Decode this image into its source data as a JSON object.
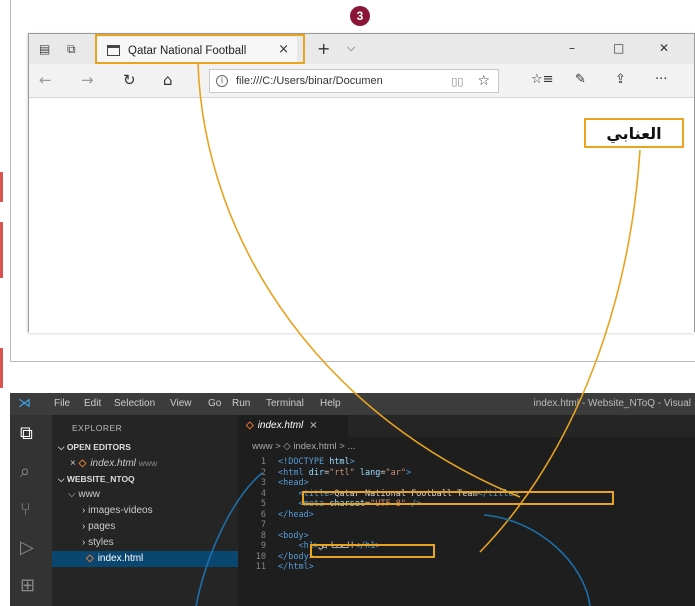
{
  "step_badge": "3",
  "colors": {
    "highlight": "#e8a320",
    "connector_blue": "#1c6fa8",
    "badge": "#8b1538",
    "vscode_bg": "#1e1e1e"
  },
  "browser": {
    "icons": {
      "tab_actions": "tab-actions-icon",
      "tab_preview": "tab-preview-icon",
      "page": "page-icon"
    },
    "tab_title": "Qatar National Football",
    "tab_close": "×",
    "new_tab": "+",
    "tab_list": "⌵",
    "window_buttons": {
      "minimize": "–",
      "maximize": "□",
      "close": "✕"
    },
    "nav": {
      "back": "←",
      "forward": "→",
      "refresh": "↻",
      "home": "⌂"
    },
    "address_url": "file:///C:/Users/binar/Documen",
    "toolbar_icons": [
      "favorites-icon",
      "pen-icon",
      "share-icon",
      "more-icon"
    ],
    "page_heading": "العنابي"
  },
  "vscode": {
    "menu": [
      "File",
      "Edit",
      "Selection",
      "View",
      "Go",
      "Run",
      "Terminal",
      "Help"
    ],
    "window_title": "index.html - Website_NToQ - Visual",
    "explorer": {
      "title": "EXPLORER",
      "open_editors_label": "OPEN EDITORS",
      "open_file": "index.html",
      "open_file_folder": "www",
      "workspace_label": "WEBSITE_NTOQ",
      "folder": "www",
      "subfolders": [
        "images-videos",
        "pages",
        "styles"
      ],
      "file": "index.html"
    },
    "editor_tab": "index.html",
    "breadcrumb": "www > ◇ index.html > ...",
    "code_lines": [
      {
        "n": "1",
        "parts": [
          [
            "tg",
            "<!DOCTYPE "
          ],
          [
            "at",
            "html"
          ],
          [
            "tg",
            ">"
          ]
        ]
      },
      {
        "n": "2",
        "parts": [
          [
            "tg",
            "<html "
          ],
          [
            "at",
            "dir"
          ],
          [
            "tx",
            "="
          ],
          [
            "st",
            "\"rtl\""
          ],
          [
            "tx",
            " "
          ],
          [
            "at",
            "lang"
          ],
          [
            "tx",
            "="
          ],
          [
            "st",
            "\"ar\""
          ],
          [
            "tg",
            ">"
          ]
        ]
      },
      {
        "n": "3",
        "parts": [
          [
            "tg",
            "<head>"
          ]
        ]
      },
      {
        "n": "4",
        "parts": [
          [
            "tx",
            "    "
          ],
          [
            "tg",
            "<title>"
          ],
          [
            "tx",
            "Qatar National Football Team"
          ],
          [
            "tg",
            "</title>"
          ]
        ]
      },
      {
        "n": "5",
        "parts": [
          [
            "tx",
            "    "
          ],
          [
            "tg",
            "<meta "
          ],
          [
            "at",
            "charset"
          ],
          [
            "tx",
            "="
          ],
          [
            "st",
            "\"UTF-8\""
          ],
          [
            "tx",
            " "
          ],
          [
            "tg",
            "/>"
          ]
        ]
      },
      {
        "n": "6",
        "parts": [
          [
            "tg",
            "</head>"
          ]
        ]
      },
      {
        "n": "7",
        "parts": []
      },
      {
        "n": "8",
        "parts": [
          [
            "tg",
            "<body>"
          ]
        ]
      },
      {
        "n": "9",
        "parts": [
          [
            "tx",
            "    "
          ],
          [
            "tg",
            "<h1>"
          ],
          [
            "tx",
            "العنابي"
          ],
          [
            "tg",
            "</h1>"
          ]
        ]
      },
      {
        "n": "10",
        "parts": [
          [
            "tg",
            "</body>"
          ]
        ]
      },
      {
        "n": "11",
        "parts": [
          [
            "tg",
            "</html>"
          ]
        ]
      }
    ]
  }
}
